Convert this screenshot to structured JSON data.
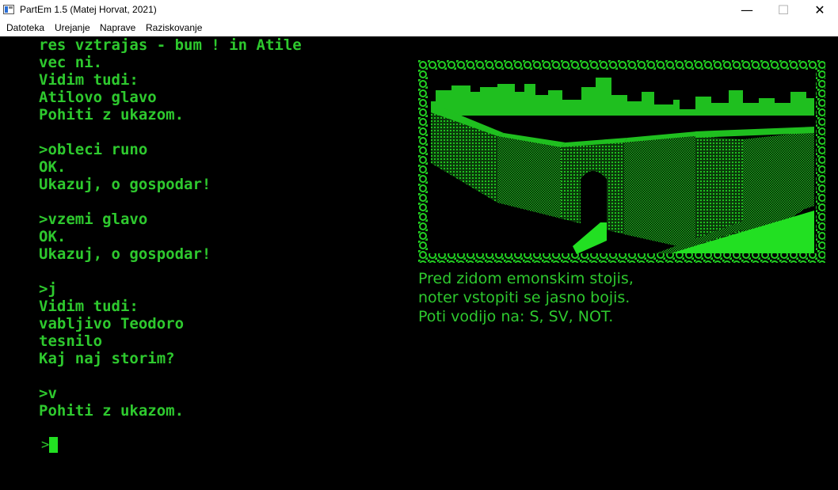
{
  "window": {
    "title": "PartEm 1.5 (Matej Horvat, 2021)",
    "minimize": "—",
    "maximize": "☐",
    "close": "✕"
  },
  "menu": {
    "items": [
      "Datoteka",
      "Urejanje",
      "Naprave",
      "Raziskovanje"
    ]
  },
  "terminal": {
    "transcript": "res vztrajas - bum ! in Atile\nvec ni.\nVidim tudi:\nAtilovo glavo\nPohiti z ukazom.\n\n>obleci runo\nOK.\nUkazuj, o gospodar!\n\n>vzemi glavo\nOK.\nUkazuj, o gospodar!\n\n>j\nVidim tudi:\nvabljivo Teodoro\ntesnilo\nKaj naj storim?\n\n>v\nPohiti z ukazom.",
    "prompt": ">",
    "text_color": "#2ec92e",
    "background": "#000000"
  },
  "location": {
    "description": "Pred zidom emonskim stojis,\nnoter vstopiti se jasno bojis.\nPoti vodijo na: S, SV, NOT."
  }
}
